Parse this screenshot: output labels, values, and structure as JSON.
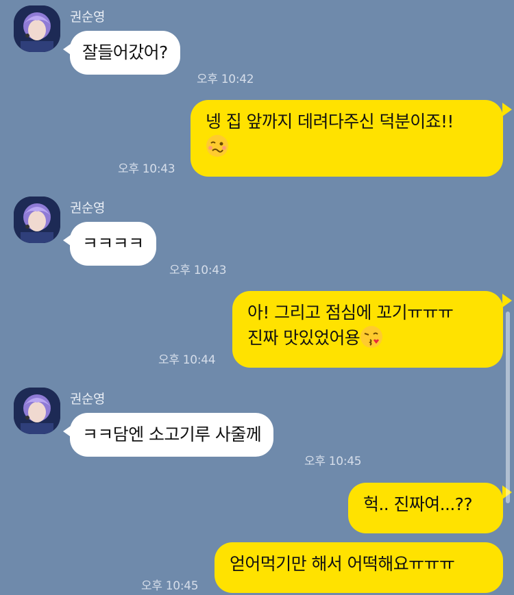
{
  "colors": {
    "background": "#6f8aab",
    "incoming_bubble": "#ffffff",
    "outgoing_bubble": "#ffe200"
  },
  "sender_name": "권순영",
  "messages": [
    {
      "dir": "in",
      "text": "잘들어갔어?",
      "time": "오후 10:42"
    },
    {
      "dir": "out",
      "line1": "넹 집 앞까지 데려다주신 덕분이죠!!",
      "emoji": "woozy-face-icon",
      "time": "오후 10:43"
    },
    {
      "dir": "in",
      "text": "ㅋㅋㅋㅋ",
      "time": "오후 10:43"
    },
    {
      "dir": "out",
      "line1": "아! 그리고 점심에 꼬기ㅠㅠㅠ",
      "line2": "진짜 맛있었어용",
      "emoji": "kissing-face-icon",
      "time": "오후 10:44"
    },
    {
      "dir": "in",
      "text": "ㅋㅋ담엔 소고기루 사줄께",
      "time": "오후 10:45"
    },
    {
      "dir": "out",
      "text": "헉.. 진짜여...??"
    },
    {
      "dir": "out",
      "text": "얻어먹기만 해서 어떡해요ㅠㅠㅠ",
      "time": "오후 10:45"
    }
  ]
}
